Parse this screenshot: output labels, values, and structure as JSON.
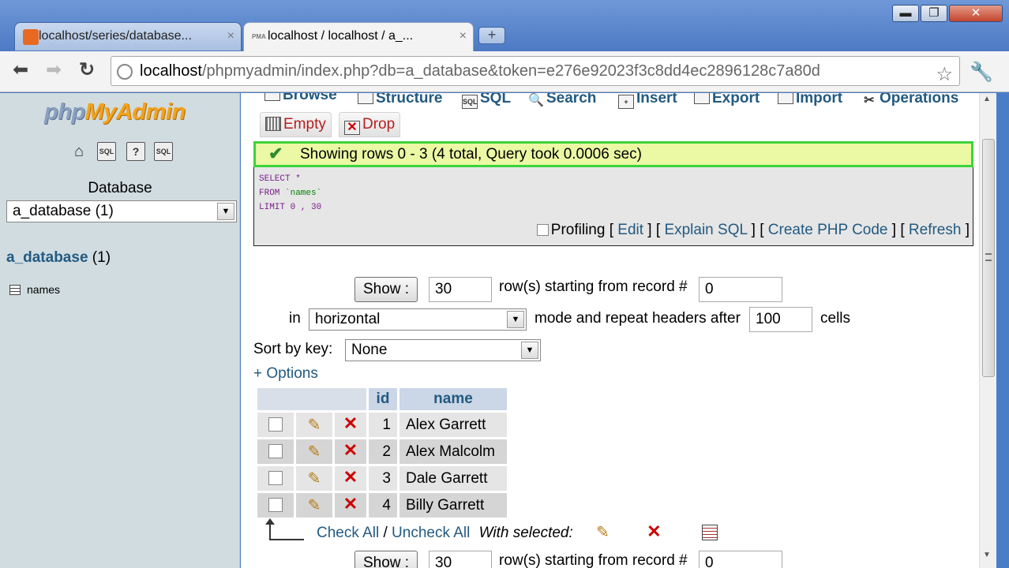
{
  "window": {
    "minimize": "▬",
    "maximize": "❐",
    "close": "✕"
  },
  "tabs": [
    {
      "label": "localhost/series/database...",
      "close": "×"
    },
    {
      "label": "localhost / localhost / a_...",
      "close": "×"
    }
  ],
  "newtab": "+",
  "nav": {
    "back": "⬅",
    "forward": "➡",
    "reload": "↻",
    "url_host": "localhost",
    "url_path": "/phpmyadmin/index.php?db=a_database&token=e276e92023f3c8dd4ec2896128c7a80d",
    "star": "☆",
    "wrench": "🔧"
  },
  "sidebar": {
    "logo_php": "php",
    "logo_myadmin": "MyAdmin",
    "icons": [
      "home-icon",
      "sql-icon",
      "help-icon",
      "query-icon"
    ],
    "sql_icon_text": "SQL",
    "database_label": "Database",
    "database_selected": "a_database (1)",
    "db_link_name": "a_database",
    "db_link_count": " (1)",
    "tables": [
      "names"
    ]
  },
  "topnav": {
    "browse": "Browse",
    "structure": "Structure",
    "sql": "SQL",
    "search": "Search",
    "insert": "Insert",
    "export": "Export",
    "import": "Import",
    "operations": "Operations",
    "empty": "Empty",
    "drop": "Drop"
  },
  "message": {
    "success": "Showing rows 0 - 3 (4 total, Query took 0.0006 sec)"
  },
  "query": {
    "line1_kw": "SELECT",
    "line1_rest": " *",
    "line2_kw": "FROM",
    "line2_table": " `names`",
    "line3_kw": "LIMIT",
    "line3_rest": " 0 , 30"
  },
  "query_actions": {
    "profiling": "Profiling",
    "edit": "Edit",
    "explain": "Explain SQL",
    "create_php": "Create PHP Code",
    "refresh": "Refresh"
  },
  "nav_form": {
    "show_button": "Show :",
    "rows_value": "30",
    "starting_label": "row(s) starting from record #",
    "start_value": "0",
    "in_label": "in",
    "mode_selected": "horizontal",
    "mode_label": "mode and repeat headers after",
    "repeat_value": "100",
    "cells_label": "cells",
    "sort_label": "Sort by key:",
    "sort_selected": "None",
    "options_link": "+ Options"
  },
  "table": {
    "columns": [
      "id",
      "name"
    ],
    "rows": [
      {
        "id": "1",
        "name": "Alex Garrett"
      },
      {
        "id": "2",
        "name": "Alex Malcolm"
      },
      {
        "id": "3",
        "name": "Dale Garrett"
      },
      {
        "id": "4",
        "name": "Billy Garrett"
      }
    ]
  },
  "bulk": {
    "check_all": "Check All",
    "separator": " / ",
    "uncheck_all": "Uncheck All",
    "with_selected": "With selected:"
  },
  "icons": {
    "pencil": "✎",
    "delete": "✕",
    "check": "✔",
    "dropdown": "▼"
  }
}
